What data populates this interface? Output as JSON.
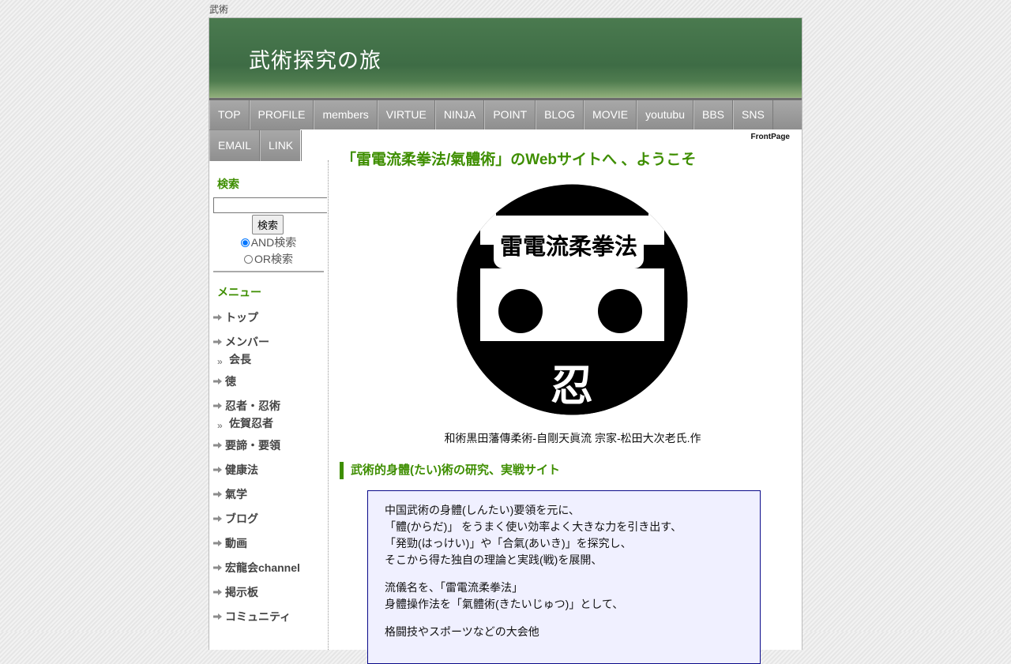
{
  "site_label": "武術",
  "header": {
    "title": "武術探究の旅"
  },
  "nav": {
    "row1": [
      "TOP",
      "PROFILE",
      "members",
      "VIRTUE",
      "NINJA",
      "POINT",
      "BLOG",
      "MOVIE",
      "youtubu",
      "BBS",
      "SNS"
    ],
    "row2": [
      "EMAIL",
      "LINK"
    ]
  },
  "sidebar": {
    "search_heading": "検索",
    "search_value": "",
    "search_button": "検索",
    "radio_and": "AND検索",
    "radio_or": "OR検索",
    "menu_heading": "メニュー",
    "menu": [
      {
        "label": "トップ",
        "sub": false
      },
      {
        "label": "メンバー",
        "sub": false
      },
      {
        "label": "会長",
        "sub": true
      },
      {
        "label": "徳",
        "sub": false
      },
      {
        "label": "忍者・忍術",
        "sub": false
      },
      {
        "label": "佐賀忍者",
        "sub": true
      },
      {
        "label": "要諦・要領",
        "sub": false
      },
      {
        "label": "健康法",
        "sub": false
      },
      {
        "label": "氣学",
        "sub": false
      },
      {
        "label": "ブログ",
        "sub": false
      },
      {
        "label": "動画",
        "sub": false
      },
      {
        "label": "宏龍会channel",
        "sub": false
      },
      {
        "label": "掲示板",
        "sub": false
      },
      {
        "label": "コミュニティ",
        "sub": false
      }
    ]
  },
  "main": {
    "breadcrumb": "FrontPage",
    "welcome": "「雷電流柔拳法/氣體術」のWebサイトへ 、ようこそ",
    "logo_text": "雷電流柔拳法",
    "logo_glyph": "忍",
    "caption": "和術黒田藩傳柔術-自剛天眞流 宗家-松田大次老氏.作",
    "section_heading": "武術的身體(たい)術の研究、実戦サイト",
    "box_paragraphs": [
      [
        "中国武術の身體(しんたい)要領を元に、",
        "「體(からだ)」 をうまく使い効率よく大きな力を引き出す、",
        "「発勁(はっけい)」や「合氣(あいき)」を探究し、",
        "そこから得た独自の理論と実践(戦)を展開、"
      ],
      [
        "流儀名を、「雷電流柔拳法」",
        "身體操作法を「氣體術(きたいじゅつ)」として、"
      ],
      [
        "格闘技やスポーツなどの大会他"
      ]
    ]
  },
  "colors": {
    "accent_green": "#3e8e00",
    "header_green": "#3e6c45",
    "box_border": "#0a0a8a",
    "box_bg": "#f0f0ff"
  }
}
